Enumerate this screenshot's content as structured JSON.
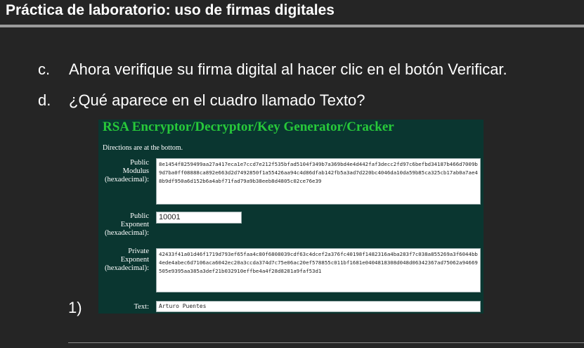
{
  "slide": {
    "title": "Práctica de laboratorio: uso de firmas digitales",
    "steps": [
      {
        "marker": "c.",
        "text": "Ahora verifique su firma digital al hacer clic en el botón Verificar."
      },
      {
        "marker": "d.",
        "text": "¿Qué aparece en el cuadro llamado Texto?"
      }
    ],
    "sub_marker": "1)"
  },
  "app": {
    "title": "RSA Encryptor/Decryptor/Key Generator/Cracker",
    "directions": "Directions are at the bottom.",
    "public_modulus": {
      "label_lines": [
        "Public",
        "Modulus",
        "(hexadecimal):"
      ],
      "value": "8e1454f8259499aa27a417eca1e7ccd7e212f535bfad5104f349b7a369bd4e4d442faf3decc2fd97c6befbd34187b466d7009b9d7ba0ff08888ca892e663d2d7492850f1a55426aa94c4d86dfab142fb5a3ad7d220bc4046da10da59b85ca325cb17ab0a7ae48b9df950a6d152b6a4abf71fad79a9b38eeb8d4805c02ce76e39"
    },
    "public_exponent": {
      "label_lines": [
        "Public",
        "Exponent",
        "(hexadecimal):"
      ],
      "value": "10001"
    },
    "private_exponent": {
      "label_lines": [
        "Private",
        "Exponent",
        "(hexadecimal):"
      ],
      "value": "42433f41a01d46f1719d793ef65faa4c80f6808039cdf63c4dcef2a376fc40198f1482316a4ba283f7c038a855269a3f6044bb4ede4abec6d7106aca6042ec20a3ccda374d7c75e06ac20ef578855c011bf1681e0404818308d048d06342367ad75062a94669505e9395aa385a3def21b032910effbe4a4f28d8281a9faf53d1"
    },
    "text_field": {
      "label": "Text:",
      "value": "Arturo Puentes"
    }
  },
  "colors": {
    "background": "#252525",
    "app_background": "#0a3630",
    "app_title": "#27c93a"
  }
}
